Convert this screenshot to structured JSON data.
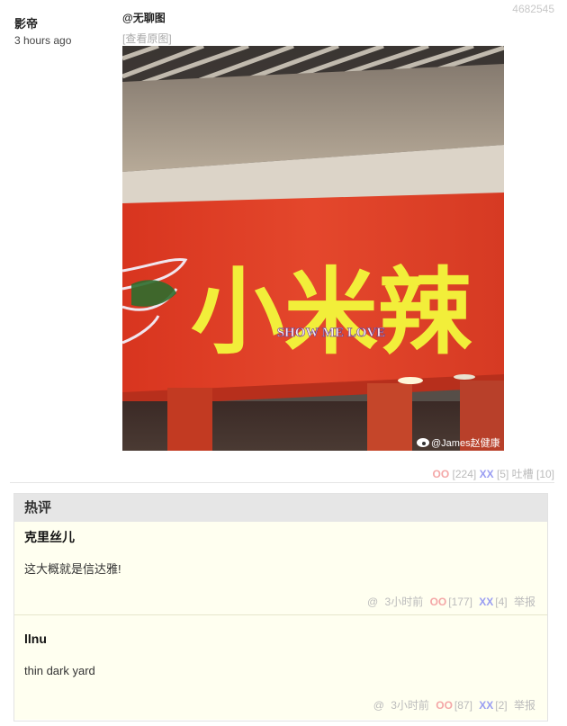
{
  "post": {
    "id": "4682545",
    "author": "影帝",
    "time": "3 hours ago",
    "mention": "@无聊图",
    "view_original": "[查看原图]",
    "image": {
      "sign_main": "小米辣",
      "sign_sub": "SHOW ME LOVE",
      "watermark": "@James赵健康"
    },
    "votes": {
      "oo_label": "OO",
      "oo_count": "[224]",
      "xx_label": "XX",
      "xx_count": "[5]",
      "tucao_label": "吐槽",
      "tucao_count": "[10]"
    }
  },
  "hot": {
    "title": "热评",
    "comments": [
      {
        "author": "克里丝儿",
        "text": "这大概就是信达雅!",
        "at": "@",
        "time": "3小时前",
        "oo_label": "OO",
        "oo_count": "[177]",
        "xx_label": "XX",
        "xx_count": "[4]",
        "report": "举报"
      },
      {
        "author": "llnu",
        "text": "thin dark yard",
        "at": "@",
        "time": "3小时前",
        "oo_label": "OO",
        "oo_count": "[87]",
        "xx_label": "XX",
        "xx_count": "[2]",
        "report": "举报"
      }
    ]
  },
  "colors": {
    "sign_red": "#e0402a",
    "sign_yellow": "#f2ee3a",
    "oo": "#f4a7a7",
    "xx": "#9a9ef2",
    "comment_bg": "#fffff0"
  },
  "icons": [
    "weibo-icon"
  ]
}
